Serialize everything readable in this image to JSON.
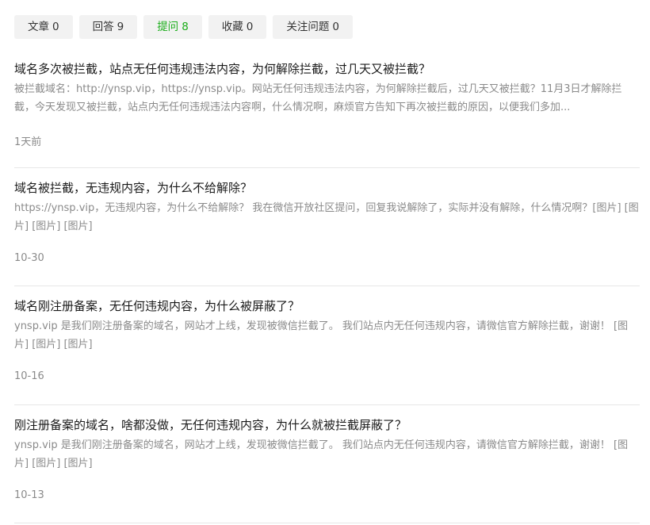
{
  "tabs": [
    {
      "label": "文章",
      "count": "0",
      "active": false
    },
    {
      "label": "回答",
      "count": "9",
      "active": false
    },
    {
      "label": "提问",
      "count": "8",
      "active": true
    },
    {
      "label": "收藏",
      "count": "0",
      "active": false
    },
    {
      "label": "关注问题",
      "count": "0",
      "active": false
    }
  ],
  "questions": [
    {
      "title": "域名多次被拦截，站点无任何违规违法内容，为何解除拦截，过几天又被拦截？",
      "summary": "被拦截域名：http://ynsp.vip，https://ynsp.vip。网站无任何违规违法内容，为何解除拦截后，过几天又被拦截？11月3日才解除拦截，今天发现又被拦截，站点内无任何违规违法内容啊，什么情况啊，麻烦官方告知下再次被拦截的原因，以便我们多加...",
      "date": "1天前"
    },
    {
      "title": "域名被拦截，无违规内容，为什么不给解除？",
      "summary": "https://ynsp.vip，无违规内容，为什么不给解除？ 我在微信开放社区提问，回复我说解除了，实际并没有解除，什么情况啊？[图片] [图片] [图片] [图片]",
      "date": "10-30"
    },
    {
      "title": "域名刚注册备案，无任何违规内容，为什么被屏蔽了？",
      "summary": "ynsp.vip 是我们刚注册备案的域名，网站才上线，发现被微信拦截了。 我们站点内无任何违规内容，请微信官方解除拦截，谢谢！ [图片] [图片] [图片]",
      "date": "10-16"
    },
    {
      "title": "刚注册备案的域名，啥都没做，无任何违规内容，为什么就被拦截屏蔽了？",
      "summary": "ynsp.vip 是我们刚注册备案的域名，网站才上线，发现被微信拦截了。 我们站点内无任何违规内容，请微信官方解除拦截，谢谢！ [图片] [图片] [图片]",
      "date": "10-13"
    }
  ]
}
